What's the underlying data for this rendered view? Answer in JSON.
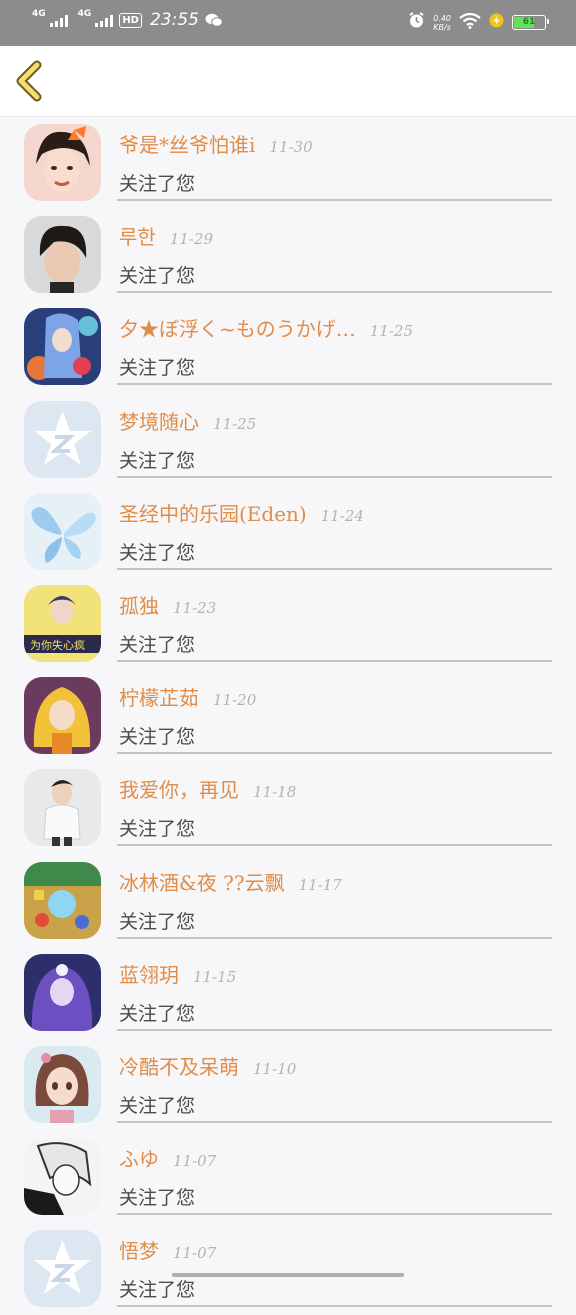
{
  "status_bar": {
    "network1": "4G",
    "network2": "4G",
    "hd": "HD",
    "time": "23:55",
    "speed_value": "0.40",
    "speed_unit": "KB/s",
    "battery": "61"
  },
  "colors": {
    "name": "#e08d4a",
    "date": "#b8b2ad",
    "back_icon_fill": "#f7dc6f",
    "back_icon_stroke": "#6b5a1a"
  },
  "items": [
    {
      "name": "爷是*丝爷怕谁i",
      "date": "11-30",
      "message": "关注了您",
      "avatar": "avatar-girl-bow-icon"
    },
    {
      "name": "루한",
      "date": "11-29",
      "message": "关注了您",
      "avatar": "avatar-boy-dark-hair-icon"
    },
    {
      "name": "夕★ぼ浮く~ものうかげ…",
      "date": "11-25",
      "message": "关注了您",
      "avatar": "avatar-anime-blue-icon"
    },
    {
      "name": "梦境随心",
      "date": "11-25",
      "message": "关注了您",
      "avatar": "avatar-qq-default-icon"
    },
    {
      "name": "圣经中的乐园(Eden)",
      "date": "11-24",
      "message": "关注了您",
      "avatar": "avatar-butterfly-icon"
    },
    {
      "name": "孤独",
      "date": "11-23",
      "message": "关注了您",
      "avatar": "avatar-yellow-flowers-icon"
    },
    {
      "name": "柠檬芷茹",
      "date": "11-20",
      "message": "关注了您",
      "avatar": "avatar-anime-blonde-icon"
    },
    {
      "name": "我爱你，再见",
      "date": "11-18",
      "message": "关注了您",
      "avatar": "avatar-boy-white-shirt-icon"
    },
    {
      "name": "冰林酒&夜 ??云飘",
      "date": "11-17",
      "message": "关注了您",
      "avatar": "avatar-game-scene-icon"
    },
    {
      "name": "蓝翎玥",
      "date": "11-15",
      "message": "关注了您",
      "avatar": "avatar-anime-purple-icon"
    },
    {
      "name": "冷酷不及呆萌",
      "date": "11-10",
      "message": "关注了您",
      "avatar": "avatar-doll-girl-icon"
    },
    {
      "name": "ふゆ",
      "date": "11-07",
      "message": "关注了您",
      "avatar": "avatar-manga-bw-icon"
    },
    {
      "name": "悟梦",
      "date": "11-07",
      "message": "关注了您",
      "avatar": "avatar-qq-default-icon"
    }
  ]
}
